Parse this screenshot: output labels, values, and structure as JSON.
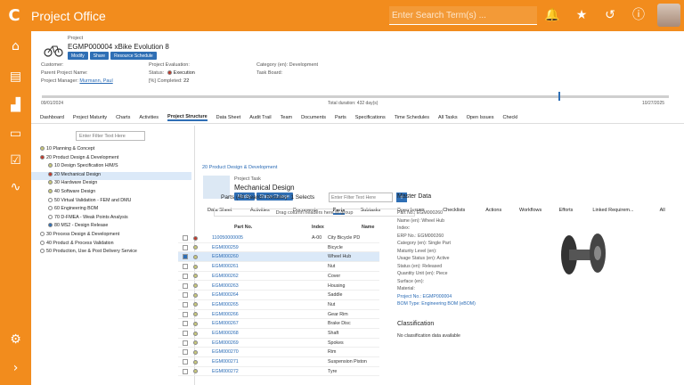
{
  "app": {
    "title": "Project Office",
    "search_placeholder": "Enter Search Term(s) ..."
  },
  "project": {
    "label": "Project",
    "name": "EGMP000004 xBike Evolution 8",
    "btn_modify": "Modify",
    "btn_share": "Share",
    "btn_resource": "Resource Schedule",
    "customer": "Customer:",
    "parent": "Parent Project Name:",
    "manager_label": "Project Manager:",
    "manager": "Murmann, Paul",
    "eval": "Project Evaluation:",
    "status_label": "Status:",
    "status": "Execution",
    "completed_label": "[%] Completed:",
    "completed": "22",
    "category": "Category (en): Development",
    "taskboard": "Task Board:",
    "start": "09/01/2024",
    "duration": "Total duration: 432 day(s)",
    "end": "10/27/2025"
  },
  "tabs": [
    "Dashboard",
    "Project Maturity",
    "Charts",
    "Activities",
    "Project Structure",
    "Data Sheet",
    "Audit Trail",
    "Team",
    "Documents",
    "Parts",
    "Specifications",
    "Time Schedules",
    "All Tasks",
    "Open Issues",
    "Checkl"
  ],
  "tree": {
    "filter": "Enter Filter Text Here",
    "items": [
      {
        "t": "10 Planning & Concept",
        "c": "#c8c87a"
      },
      {
        "t": "20 Product Design & Development",
        "c": "#c0392b"
      },
      {
        "t": "10 Design Specification H/M/S",
        "c": "#c8c87a"
      },
      {
        "t": "20 Mechanical Design",
        "c": "#c0392b"
      },
      {
        "t": "30 Hardware Design",
        "c": "#c8c87a"
      },
      {
        "t": "40 Software Design",
        "c": "#c8c87a"
      },
      {
        "t": "50 Virtual Validation - FEM and DMU",
        "c": "#fff"
      },
      {
        "t": "60 Engineering BOM",
        "c": "#fff"
      },
      {
        "t": "70 D-FMEA - Weak Points Analysis",
        "c": "#fff"
      },
      {
        "t": "80 MS2 - Design Release",
        "c": "#2f6fb5"
      },
      {
        "t": "30 Process Design & Development",
        "c": "#fff"
      },
      {
        "t": "40 Product & Process Validation",
        "c": "#fff"
      },
      {
        "t": "50 Production, Use & Post Delivery Service",
        "c": "#fff"
      }
    ]
  },
  "task": {
    "crumb": "20 Product Design & Development",
    "label": "Project Task",
    "name": "Mechanical Design",
    "btn_modify": "Modify",
    "btn_status": "Status Change",
    "tabs": [
      "Data Sheet",
      "Activities",
      "Documents",
      "Parts",
      "Subtasks",
      "Open Issues",
      "Checklists",
      "Actions",
      "Workflows",
      "Efforts",
      "Linked Requirem...",
      "All"
    ]
  },
  "parts": {
    "title": "Parts (49 Search Results)- 1 Selects",
    "filter": "Enter Filter Text Here",
    "group": "Drag column headers here to group",
    "h_partno": "Part No.",
    "h_index": "Index",
    "h_name": "Name",
    "rows": [
      [
        "110050000005",
        "A-00",
        "City Bicycle PD"
      ],
      [
        "EGM000259",
        "",
        "Bicycle"
      ],
      [
        "EGM000260",
        "",
        "Wheel Hub"
      ],
      [
        "EGM000261",
        "",
        "Nut"
      ],
      [
        "EGM000262",
        "",
        "Cover"
      ],
      [
        "EGM000263",
        "",
        "Housing"
      ],
      [
        "EGM000264",
        "",
        "Saddle"
      ],
      [
        "EGM000265",
        "",
        "Nut"
      ],
      [
        "EGM000266",
        "",
        "Gear Rim"
      ],
      [
        "EGM000267",
        "",
        "Brake Disc"
      ],
      [
        "EGM000268",
        "",
        "Shaft"
      ],
      [
        "EGM000269",
        "",
        "Spokes"
      ],
      [
        "EGM000270",
        "",
        "Rim"
      ],
      [
        "EGM000271",
        "",
        "Suspension Piston"
      ],
      [
        "EGM000272",
        "",
        "Tyre"
      ]
    ]
  },
  "master": {
    "title": "Master Data",
    "rows": [
      "Part No.: EGM000260",
      "Name (en): Wheel Hub",
      "Index:",
      "ERP No.: EGM000260",
      "Category (en): Single Part",
      "Maturity Level (en):",
      "Usage Status (en): Active",
      "Status (en): Released",
      "Quantity Unit (en): Piece",
      "Surface (en):",
      "Material:",
      "Project No.: EGMP000004",
      "BOM Type: Engineering BOM (eBOM)"
    ],
    "class_title": "Classification",
    "class_text": "No classification data available"
  }
}
